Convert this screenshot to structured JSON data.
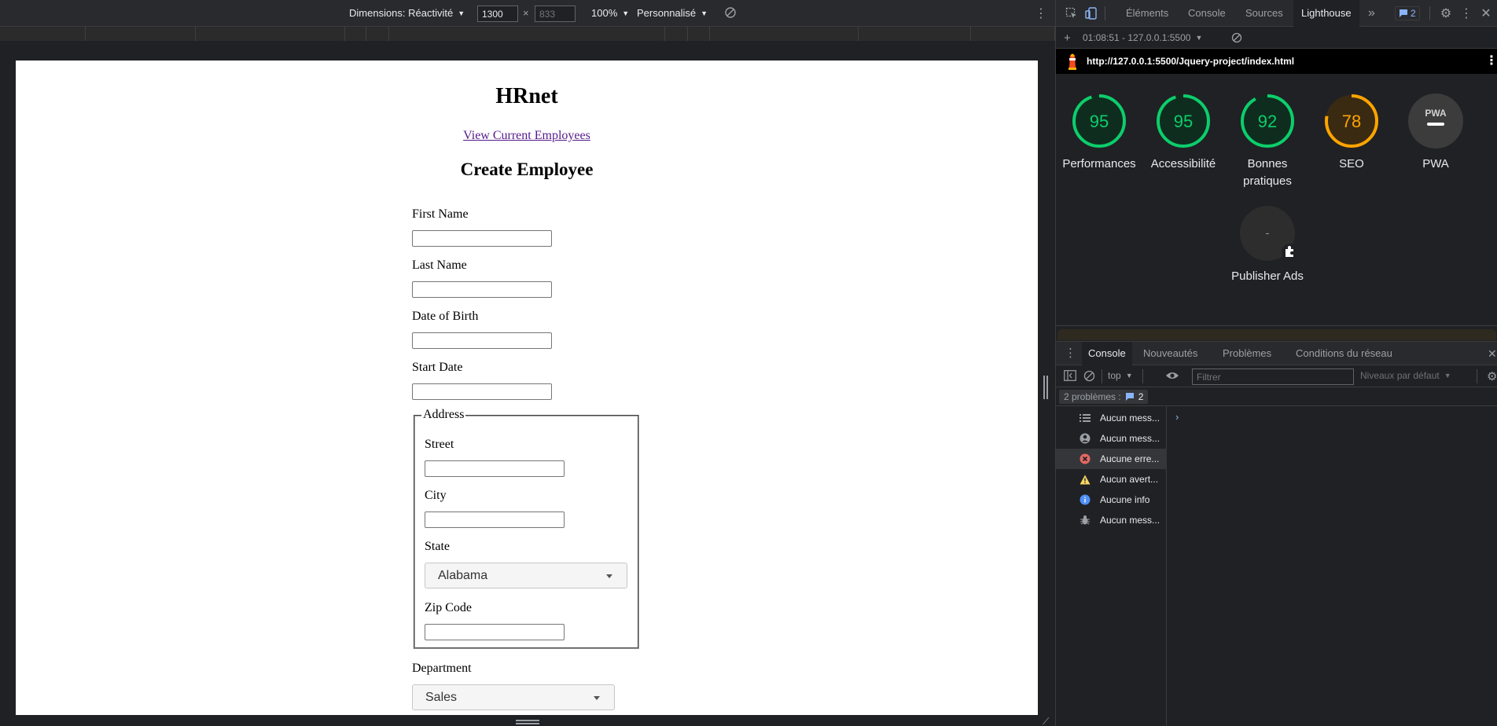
{
  "emulation": {
    "dimensions_label": "Dimensions: Réactivité",
    "width_value": "1300",
    "times": "×",
    "height_placeholder": "833",
    "zoom": "100%",
    "throttling": "Personnalisé"
  },
  "page": {
    "title": "HRnet",
    "link": "View Current Employees",
    "heading": "Create Employee",
    "fields": {
      "first_name": "First Name",
      "last_name": "Last Name",
      "dob": "Date of Birth",
      "start_date": "Start Date",
      "address_legend": "Address",
      "street": "Street",
      "city": "City",
      "state": "State",
      "state_value": "Alabama",
      "zip": "Zip Code",
      "department": "Department",
      "department_value": "Sales"
    }
  },
  "devtools": {
    "tabs": [
      "Éléments",
      "Console",
      "Sources",
      "Lighthouse"
    ],
    "more": "»",
    "issues_badge": "2",
    "lighthouse": {
      "time_host": "01:08:51 - 127.0.0.1:5500",
      "add": "+",
      "url": "http://127.0.0.1:5500/Jquery-project/index.html",
      "scores": [
        {
          "label": "Performances",
          "value": "95",
          "color": "#0cce6b"
        },
        {
          "label": "Accessibilité",
          "value": "95",
          "color": "#0cce6b"
        },
        {
          "label": "Bonnes pratiques",
          "value": "92",
          "color": "#0cce6b"
        },
        {
          "label": "SEO",
          "value": "78",
          "color": "#ffa400"
        },
        {
          "label": "PWA",
          "value": "PWA",
          "color": "#9aa0a6"
        },
        {
          "label": "Publisher Ads",
          "value": "-",
          "color": "#9aa0a6"
        }
      ]
    },
    "drawer": {
      "tabs": [
        "Console",
        "Nouveautés",
        "Problèmes",
        "Conditions du réseau"
      ],
      "context": "top",
      "filter_placeholder": "Filtrer",
      "levels": "Niveaux par défaut",
      "issues_text": "2 problèmes :",
      "issues_count": "2",
      "sidebar": [
        {
          "label": "Aucun mess...",
          "icon": "list-icon"
        },
        {
          "label": "Aucun mess...",
          "icon": "user-icon"
        },
        {
          "label": "Aucune erre...",
          "icon": "error-icon"
        },
        {
          "label": "Aucun avert...",
          "icon": "warning-icon"
        },
        {
          "label": "Aucune info",
          "icon": "info-icon"
        },
        {
          "label": "Aucun mess...",
          "icon": "bug-icon"
        }
      ],
      "prompt": "›"
    }
  }
}
